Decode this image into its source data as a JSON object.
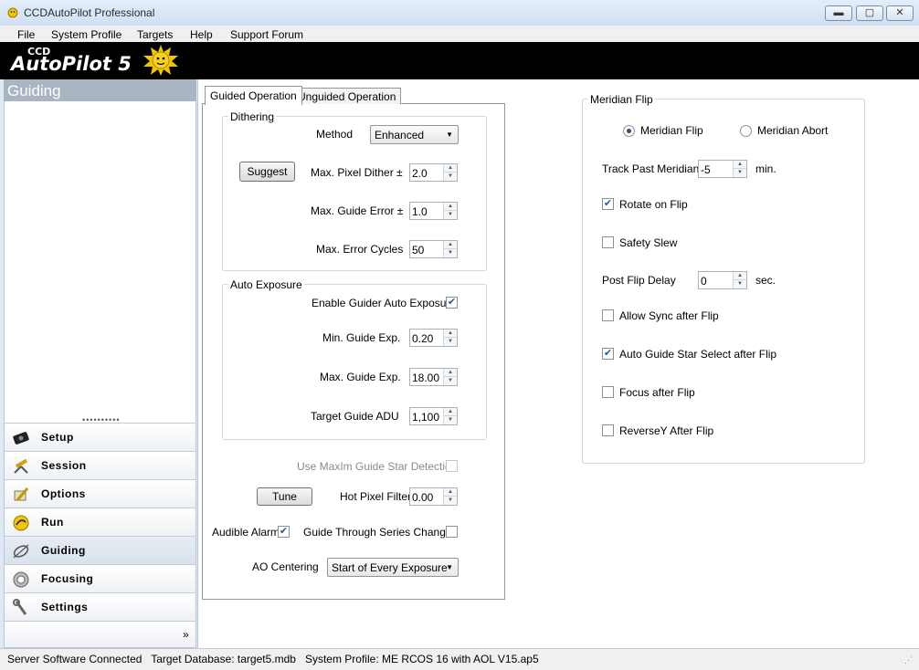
{
  "window": {
    "title": "CCDAutoPilot  Professional",
    "minimize_label": "▬",
    "maximize_label": "▢",
    "close_label": "✕"
  },
  "menu": {
    "file": "File",
    "system_profile": "System Profile",
    "targets": "Targets",
    "help": "Help",
    "support_forum": "Support Forum"
  },
  "banner": {
    "logo_ccd": "CCD",
    "logo_autopilot": "AutoPilot 5"
  },
  "left_panel": {
    "header": "Guiding",
    "nav": [
      {
        "label": "Setup",
        "icon": "camera-icon"
      },
      {
        "label": "Session",
        "icon": "telescope-icon"
      },
      {
        "label": "Options",
        "icon": "pencil-icon"
      },
      {
        "label": "Run",
        "icon": "run-icon"
      },
      {
        "label": "Guiding",
        "icon": "crosshair-icon"
      },
      {
        "label": "Focusing",
        "icon": "focus-ring-icon"
      },
      {
        "label": "Settings",
        "icon": "wrench-icon"
      }
    ],
    "expand_label": "»"
  },
  "tabs": {
    "guided": "Guided Operation",
    "unguided": "Unguided Operation"
  },
  "dithering": {
    "group_label": "Dithering",
    "method_label": "Method",
    "method_value": "Enhanced",
    "suggest_button": "Suggest",
    "max_pixel_dither_label": "Max. Pixel Dither ±",
    "max_pixel_dither_value": "2.0",
    "max_guide_error_label": "Max. Guide Error ±",
    "max_guide_error_value": "1.0",
    "max_error_cycles_label": "Max. Error Cycles",
    "max_error_cycles_value": "50"
  },
  "auto_exposure": {
    "group_label": "Auto Exposure",
    "enable_label": "Enable Guider Auto Exposure",
    "enable_checked": true,
    "min_guide_exp_label": "Min. Guide Exp.",
    "min_guide_exp_value": "0.20",
    "max_guide_exp_label": "Max. Guide Exp.",
    "max_guide_exp_value": "18.00",
    "target_guide_adu_label": "Target Guide ADU",
    "target_guide_adu_value": "1,100"
  },
  "guiding_misc": {
    "use_maxim_label": "Use MaxIm Guide Star Detection",
    "use_maxim_checked": false,
    "tune_button": "Tune",
    "hot_pixel_filter_label": "Hot Pixel Filter",
    "hot_pixel_filter_value": "0.00",
    "audible_alarm_label": "Audible Alarm",
    "audible_alarm_checked": true,
    "guide_through_label": "Guide Through Series Changes",
    "guide_through_checked": false,
    "ao_centering_label": "AO Centering",
    "ao_centering_value": "Start of Every Exposure"
  },
  "meridian": {
    "group_label": "Meridian Flip",
    "radio_flip_label": "Meridian Flip",
    "radio_abort_label": "Meridian Abort",
    "selected": "flip",
    "track_past_label": "Track Past Meridian",
    "track_past_value": "-5",
    "track_past_unit": "min.",
    "rotate_on_flip_label": "Rotate on Flip",
    "rotate_on_flip_checked": true,
    "safety_slew_label": "Safety Slew",
    "safety_slew_checked": false,
    "post_flip_delay_label": "Post Flip Delay",
    "post_flip_delay_value": "0",
    "post_flip_delay_unit": "sec.",
    "allow_sync_label": "Allow Sync after Flip",
    "allow_sync_checked": false,
    "auto_guide_star_label": "Auto Guide Star Select after Flip",
    "auto_guide_star_checked": true,
    "focus_after_label": "Focus after Flip",
    "focus_after_checked": false,
    "reverse_y_label": "ReverseY After Flip",
    "reverse_y_checked": false
  },
  "statusbar": {
    "text": "Server Software Connected   Target Database: target5.mdb   System Profile: ME RCOS 16 with AOL V15.ap5"
  },
  "colors": {
    "banner_bg": "#000000",
    "logo_star": "#f5c400",
    "nav_header_bg": "#a9b5c2",
    "check_mark": "#2a5a9a"
  }
}
